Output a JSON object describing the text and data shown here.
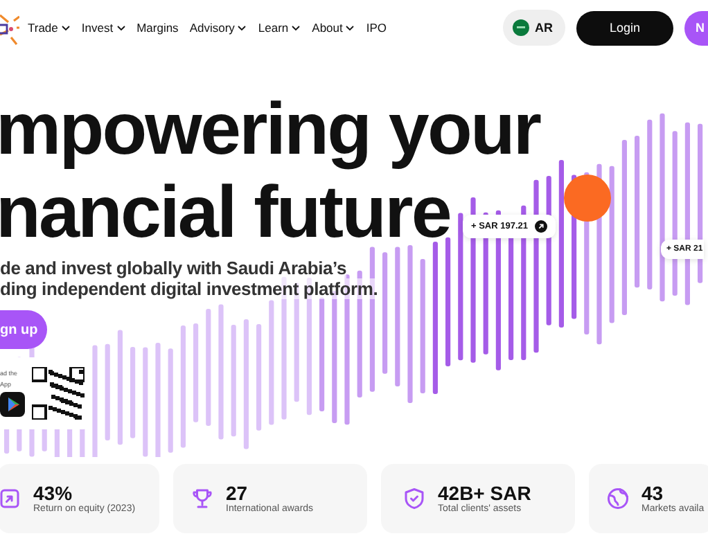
{
  "nav": {
    "items": [
      {
        "label": "Trade",
        "dropdown": true
      },
      {
        "label": "Invest",
        "dropdown": true
      },
      {
        "label": "Margins",
        "dropdown": false
      },
      {
        "label": "Advisory",
        "dropdown": true
      },
      {
        "label": "Learn",
        "dropdown": true
      },
      {
        "label": "About",
        "dropdown": true
      },
      {
        "label": "IPO",
        "dropdown": false
      }
    ],
    "language": "AR",
    "login": "Login",
    "signup_partial": "N"
  },
  "hero": {
    "heading": [
      "mpowering your",
      "nancial future"
    ],
    "subtitle": [
      "de and invest globally with Saudi Arabia’s",
      "ding independent digital investment platform."
    ],
    "cta": "gn up",
    "app_card": {
      "lines": [
        "ad the",
        "App"
      ]
    },
    "price_tags": [
      "+ SAR 197.21",
      "+ SAR 21"
    ]
  },
  "stats": [
    {
      "kind": "chart",
      "value": "43%",
      "label": "Return on equity (2023)"
    },
    {
      "kind": "trophy",
      "value": "27",
      "label": "International awards"
    },
    {
      "kind": "shield",
      "value": "42B+ SAR",
      "label": "Total clients' assets"
    },
    {
      "kind": "globe",
      "value": "43",
      "label": "Markets availa"
    }
  ]
}
